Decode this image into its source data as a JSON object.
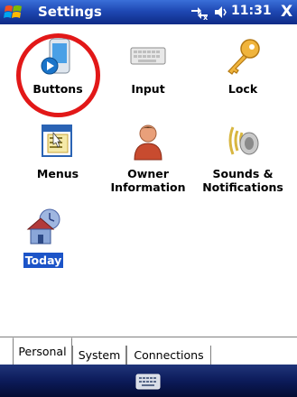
{
  "titlebar": {
    "title": "Settings",
    "clock": "11:31",
    "close_label": "X"
  },
  "items": [
    {
      "label": "Buttons",
      "icon": "buttons-icon"
    },
    {
      "label": "Input",
      "icon": "keyboard-input-icon"
    },
    {
      "label": "Lock",
      "icon": "key-lock-icon"
    },
    {
      "label": "Menus",
      "icon": "menus-icon"
    },
    {
      "label": "Owner Information",
      "label_line1": "Owner",
      "label_line2": "Information",
      "icon": "owner-icon"
    },
    {
      "label": "Sounds & Notifications",
      "label_line1": "Sounds &",
      "label_line2": "Notifications",
      "icon": "sounds-icon"
    },
    {
      "label": "Today",
      "icon": "today-icon",
      "selected": true
    }
  ],
  "tabs": [
    {
      "label": "Personal",
      "active": true
    },
    {
      "label": "System"
    },
    {
      "label": "Connections"
    }
  ],
  "colors": {
    "titlebar": "#1f49b4",
    "selection": "#1c54c8",
    "highlight_circle": "#e21818"
  }
}
